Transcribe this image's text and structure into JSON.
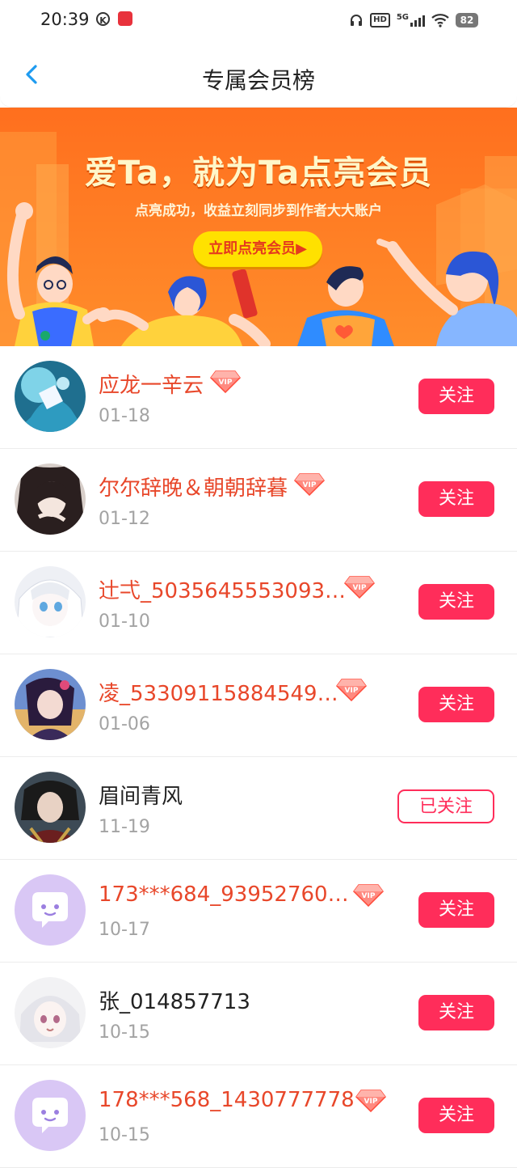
{
  "status_bar": {
    "time": "20:39",
    "k_icon": "K",
    "hd": "HD",
    "network": "5G",
    "battery": "82"
  },
  "header": {
    "title": "专属会员榜"
  },
  "banner": {
    "title": "爱Ta，就为Ta点亮会员",
    "subtitle": "点亮成功，收益立刻同步到作者大大账户",
    "button_label": "立即点亮会员▶"
  },
  "members": [
    {
      "name": "应龙一辛云",
      "date": "01-18",
      "vip": true,
      "followed": false,
      "button": "关注",
      "avatar": "anime-blue"
    },
    {
      "name": "尔尔辞晚＆朝朝辞暮",
      "date": "01-12",
      "vip": true,
      "followed": false,
      "button": "关注",
      "avatar": "anime-dark"
    },
    {
      "name": "辻弌_5035645553093…",
      "date": "01-10",
      "vip": true,
      "followed": false,
      "button": "关注",
      "avatar": "anime-white"
    },
    {
      "name": "凌_53309115884549…",
      "date": "01-06",
      "vip": true,
      "followed": false,
      "button": "关注",
      "avatar": "anime-purple"
    },
    {
      "name": "眉间青风",
      "date": "11-19",
      "vip": false,
      "followed": true,
      "button": "已关注",
      "avatar": "anime-warrior"
    },
    {
      "name": "173***684_93952760…",
      "date": "10-17",
      "vip": true,
      "followed": false,
      "button": "关注",
      "avatar": "default-chat"
    },
    {
      "name": "张_014857713",
      "date": "10-15",
      "vip": false,
      "followed": false,
      "button": "关注",
      "avatar": "anime-silver"
    },
    {
      "name": "178***568_1430777778",
      "date": "10-15",
      "vip": true,
      "followed": false,
      "button": "关注",
      "avatar": "default-chat"
    }
  ],
  "colors": {
    "vip_name": "#e8472a",
    "follow_button": "#ff2d5a",
    "banner": "#ff7a22",
    "back_arrow": "#1e9bf0"
  }
}
